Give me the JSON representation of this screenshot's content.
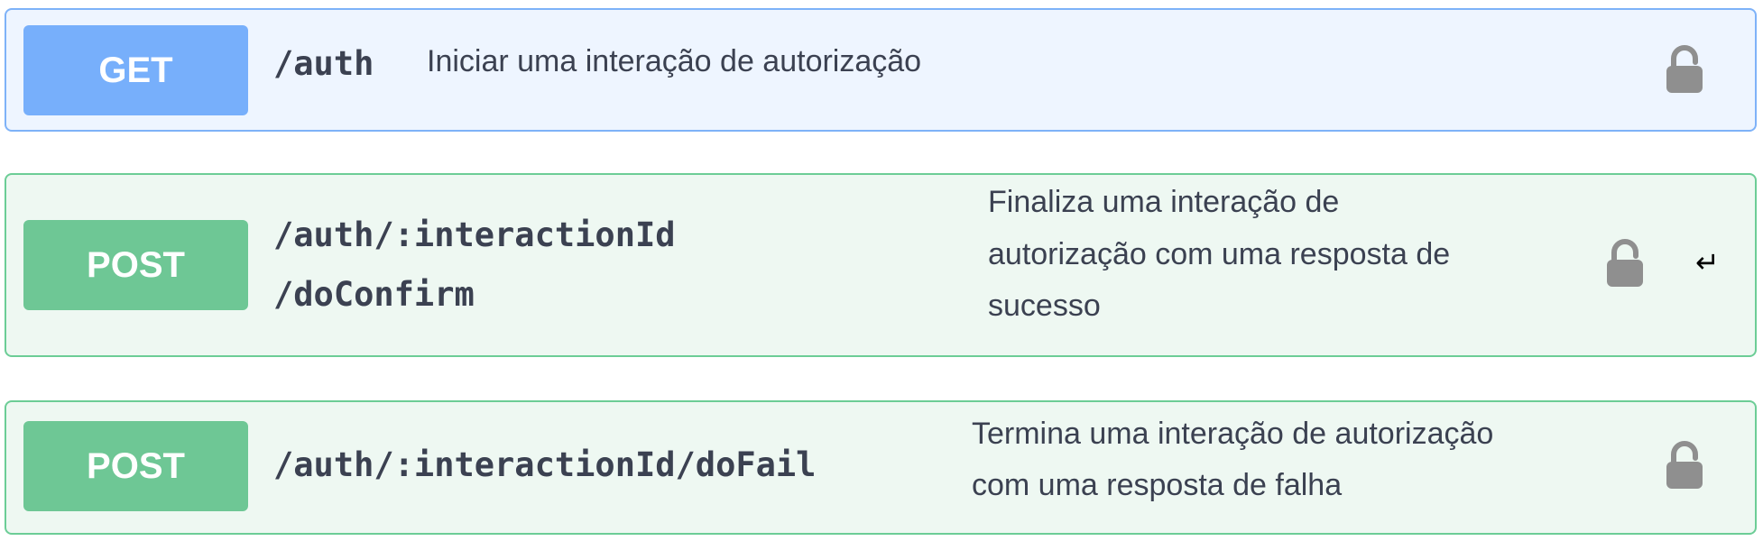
{
  "operations": [
    {
      "method": "GET",
      "path": "/auth",
      "description": "Iniciar uma interação de autorização",
      "icon": "lock-icon",
      "color": "#77affb"
    },
    {
      "method": "POST",
      "path_lines": [
        "/auth/:interactionId",
        "/doConfirm"
      ],
      "description_lines": [
        "Finaliza uma interação de",
        "autorização com uma resposta de",
        "sucesso"
      ],
      "icon": "lock-icon",
      "expand_icon": "↵",
      "color": "#6ec795"
    },
    {
      "method": "POST",
      "path": "/auth/:interactionId/doFail",
      "description_lines": [
        "Termina uma interação de autorização",
        "com uma resposta de falha"
      ],
      "icon": "lock-icon",
      "color": "#6ec795"
    }
  ]
}
